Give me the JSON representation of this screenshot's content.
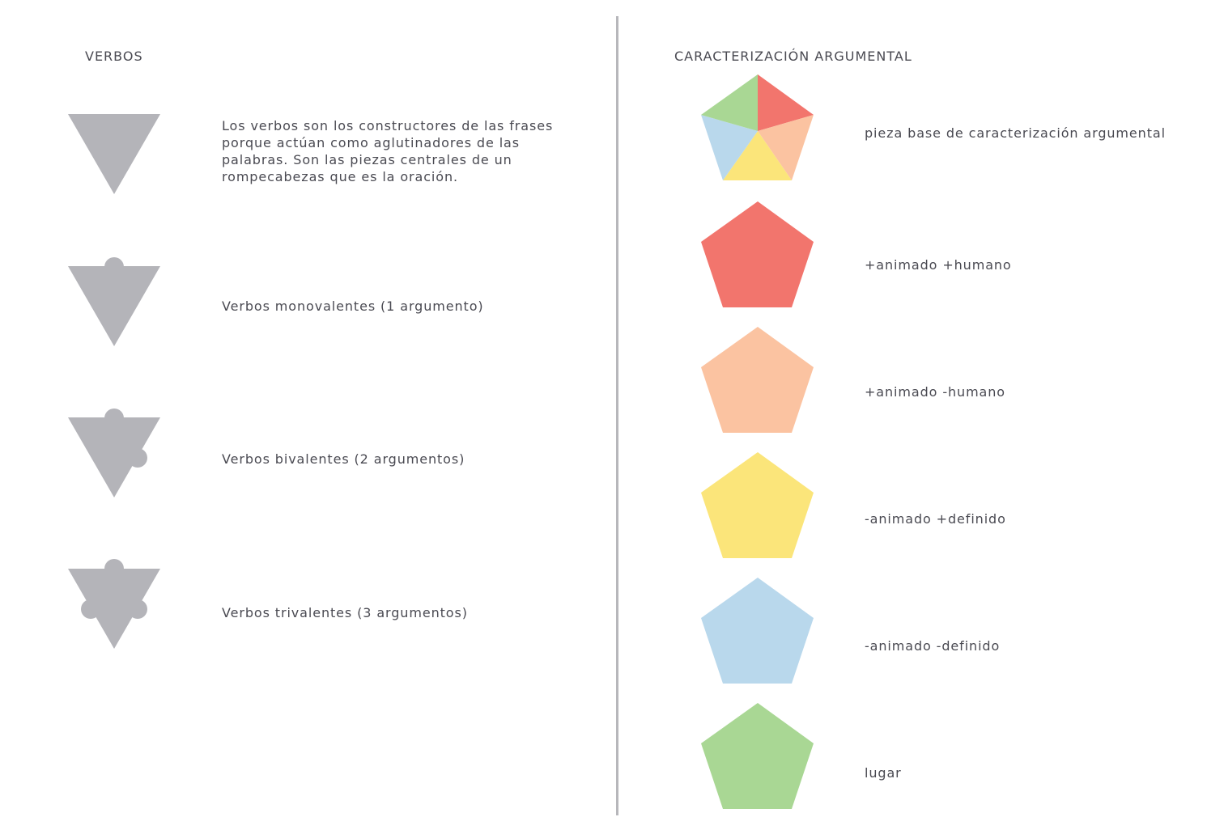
{
  "verbs": {
    "heading": "VERBOS",
    "intro": "Los verbos son los constructores de las frases porque actúan como aglutinadores de las palabras. Son las piezas centrales de un rompecabezas que es la oración.",
    "items": [
      {
        "label": "Verbos monovalentes (1 argumento)"
      },
      {
        "label": "Verbos bivalentes (2 argumentos)"
      },
      {
        "label": "Verbos trivalentes (3 argumentos)"
      }
    ],
    "shape_color": "#b4b4b9"
  },
  "arguments": {
    "heading": "CARACTERIZACIÓN ARGUMENTAL",
    "base_label": "pieza base de caracterización argumental",
    "items": [
      {
        "label": "+animado +humano",
        "color": "#f2756d"
      },
      {
        "label": "+animado -humano",
        "color": "#fbc3a1"
      },
      {
        "label": "-animado +definido",
        "color": "#fbe57a"
      },
      {
        "label": "-animado -definido",
        "color": "#b9d8ec"
      },
      {
        "label": "lugar",
        "color": "#a9d794"
      }
    ]
  }
}
